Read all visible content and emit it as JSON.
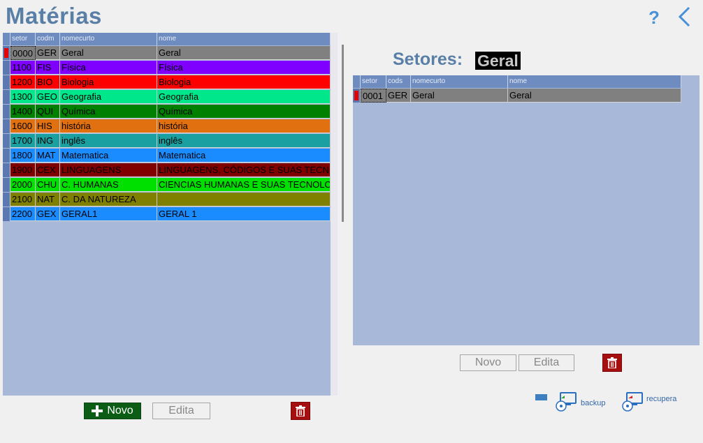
{
  "page_title": "Matérias",
  "help_label": "?",
  "materias": {
    "columns": [
      "setor",
      "codm",
      "nomecurto",
      "nome"
    ],
    "rows": [
      {
        "setor": "0000",
        "codm": "GER",
        "nomecurto": "Geral",
        "nome": "Geral",
        "color": "#808080"
      },
      {
        "setor": "1100",
        "codm": "FIS",
        "nomecurto": "Física",
        "nome": "Física",
        "color": "#8000ff"
      },
      {
        "setor": "1200",
        "codm": "BIO",
        "nomecurto": "Biologia",
        "nome": "Biologia",
        "color": "#ff0000"
      },
      {
        "setor": "1300",
        "codm": "GEO",
        "nomecurto": "Geografia",
        "nome": "Geografia",
        "color": "#00e68a"
      },
      {
        "setor": "1400",
        "codm": "QUI",
        "nomecurto": "Química",
        "nome": "Química",
        "color": "#008000"
      },
      {
        "setor": "1600",
        "codm": "HIS",
        "nomecurto": "história",
        "nome": "história",
        "color": "#e07010"
      },
      {
        "setor": "1700",
        "codm": "ING",
        "nomecurto": "inglês",
        "nome": "inglês",
        "color": "#1aa0a0"
      },
      {
        "setor": "1800",
        "codm": "MAT",
        "nomecurto": "Matematica",
        "nome": "Matematica",
        "color": "#1a8cff"
      },
      {
        "setor": "1900",
        "codm": "CEX",
        "nomecurto": "LINGUAGENS",
        "nome": "LINGUAGENS, CÓDIGOS E SUAS TECN",
        "color": "#800000"
      },
      {
        "setor": "2000",
        "codm": "CHU",
        "nomecurto": "C. HUMANAS",
        "nome": "CIENCIAS HUMANAS E SUAS TECNOLO",
        "color": "#00e000"
      },
      {
        "setor": "2100",
        "codm": "NAT",
        "nomecurto": "C. DA NATUREZA",
        "nome": "",
        "color": "#808000"
      },
      {
        "setor": "2200",
        "codm": "GEX",
        "nomecurto": "GERAL1",
        "nome": "GERAL 1",
        "color": "#1a8cff"
      }
    ],
    "novo_label": "Novo",
    "edita_label": "Edita"
  },
  "setores": {
    "label": "Setores:",
    "selected": "Geral",
    "columns": [
      "setor",
      "cods",
      "nomecurto",
      "nome"
    ],
    "rows": [
      {
        "setor": "0001",
        "cods": "GER",
        "nomecurto": "Geral",
        "nome": "Geral",
        "color": "#808080"
      }
    ],
    "novo_label": "Novo",
    "edita_label": "Edita"
  },
  "utilities": {
    "backup_label": "backup",
    "recupera_label": "recupera"
  }
}
